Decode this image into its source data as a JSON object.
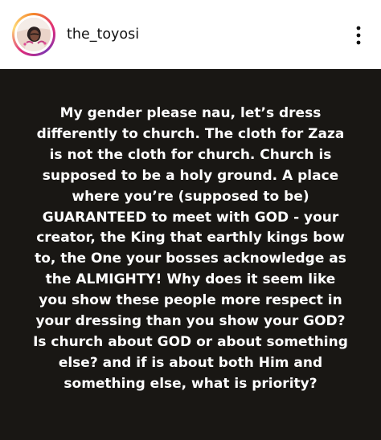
{
  "header": {
    "username": "the_toyosi",
    "avatar_icon": "profile-photo",
    "more_icon": "more-vertical-icon"
  },
  "story": {
    "lines": [
      "My gender please nau, let’s dress",
      "differently to church. The cloth for Zaza",
      "is not the cloth for church. Church is",
      "supposed to be a holy ground. A place",
      "where you’re (supposed to be)",
      "GUARANTEED to meet with GOD - your",
      "creator, the King that earthly kings bow",
      "to, the One your bosses acknowledge as",
      "the ALMIGHTY! Why does it seem like",
      "you show these people more respect in",
      "your dressing than you show your GOD?",
      "Is church about GOD or about something",
      "else? and if is about both Him and",
      "something else, what is priority?"
    ]
  },
  "colors": {
    "story_background": "#191714",
    "story_text": "#ffffff",
    "header_background": "#ffffff",
    "username_text": "#111111"
  }
}
